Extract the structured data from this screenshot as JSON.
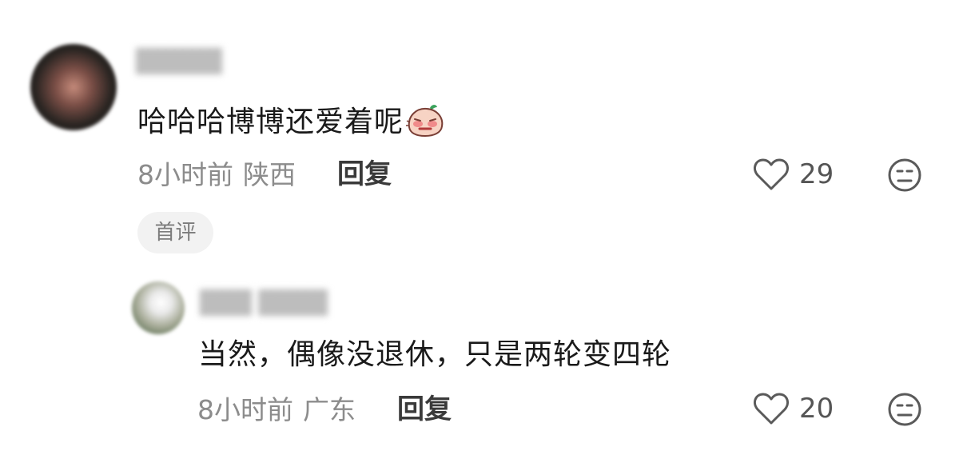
{
  "comments": [
    {
      "text": "哈哈哈博博还爱着呢",
      "emoji": "shy-blush-emoji",
      "time": "8小时前",
      "region": "陕西",
      "reply_label": "回复",
      "likes": "29",
      "badge": "首评"
    },
    {
      "text": "当然，偶像没退休，只是两轮变四轮",
      "time": "8小时前",
      "region": "广东",
      "reply_label": "回复",
      "likes": "20"
    }
  ],
  "icons": {
    "like": "heart-outline-icon",
    "dislike": "neutral-face-icon"
  },
  "colors": {
    "text": "#1a1a1a",
    "meta": "#8c8c8c",
    "badge_bg": "#f2f2f2"
  }
}
